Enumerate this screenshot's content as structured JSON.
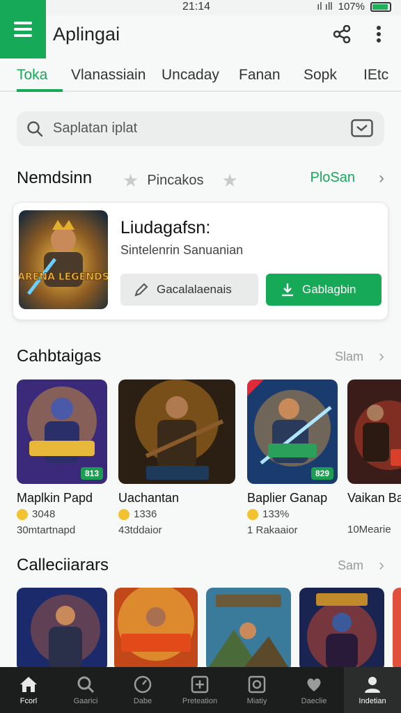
{
  "status": {
    "time": "21:14",
    "battery": "107%"
  },
  "app": {
    "title": "Aplingai"
  },
  "tabs": [
    {
      "label": "Toka"
    },
    {
      "label": "Vlanassiain"
    },
    {
      "label": "Uncaday"
    },
    {
      "label": "Fanan"
    },
    {
      "label": "Sopk"
    },
    {
      "label": "IEtc"
    }
  ],
  "search": {
    "placeholder": "Saplatan iplat"
  },
  "recommended": {
    "title": "Nemdsinn",
    "rating_label": "Pincakos",
    "link": "PloSan",
    "card": {
      "title": "Liudagafsn:",
      "subtitle": "Sintelenrin Sanuanian",
      "secondary_button": "Gacalalaenais",
      "primary_button": "Gablagbin",
      "thumb_label": "ARENA LEGENDS"
    }
  },
  "section1": {
    "title": "Cahbtaigas",
    "see_all": "Slam",
    "games": [
      {
        "name": "Maplkin Papd",
        "rating": "3048",
        "downloads": "30mtartnapd",
        "badge": "813",
        "colors": [
          "#3b2a7a",
          "#e2a12e"
        ]
      },
      {
        "name": "Uachantan",
        "rating": "1336",
        "downloads": "43tddaior",
        "badge": "",
        "colors": [
          "#2a1f12",
          "#d88a24"
        ]
      },
      {
        "name": "Baplier Ganap",
        "rating": "133%",
        "downloads": "1 Rakaaior",
        "badge": "829",
        "colors": [
          "#1a3b6e",
          "#f0a53a"
        ]
      },
      {
        "name": "Vaikan Ba",
        "rating": "",
        "downloads": "10Mearie",
        "badge": "",
        "colors": [
          "#3a1c18",
          "#c4402a"
        ]
      }
    ]
  },
  "section2": {
    "title": "Calleciiarars",
    "see_all": "Sam",
    "games": [
      {
        "colors": [
          "#1b2a6a",
          "#e06a2a"
        ]
      },
      {
        "colors": [
          "#c2481a",
          "#f4c040"
        ]
      },
      {
        "colors": [
          "#3a7a9a",
          "#6a5a3a"
        ]
      },
      {
        "colors": [
          "#1a2450",
          "#d04a2a"
        ]
      }
    ]
  },
  "bottom_nav": [
    {
      "label": "Fcorl"
    },
    {
      "label": "Gaarici"
    },
    {
      "label": "Dabe"
    },
    {
      "label": "Preteation"
    },
    {
      "label": "Miatiy"
    },
    {
      "label": "Daeclie"
    },
    {
      "label": "Indetian"
    }
  ],
  "colors": {
    "accent": "#16a957",
    "nav_bg": "#1c1d1d"
  }
}
